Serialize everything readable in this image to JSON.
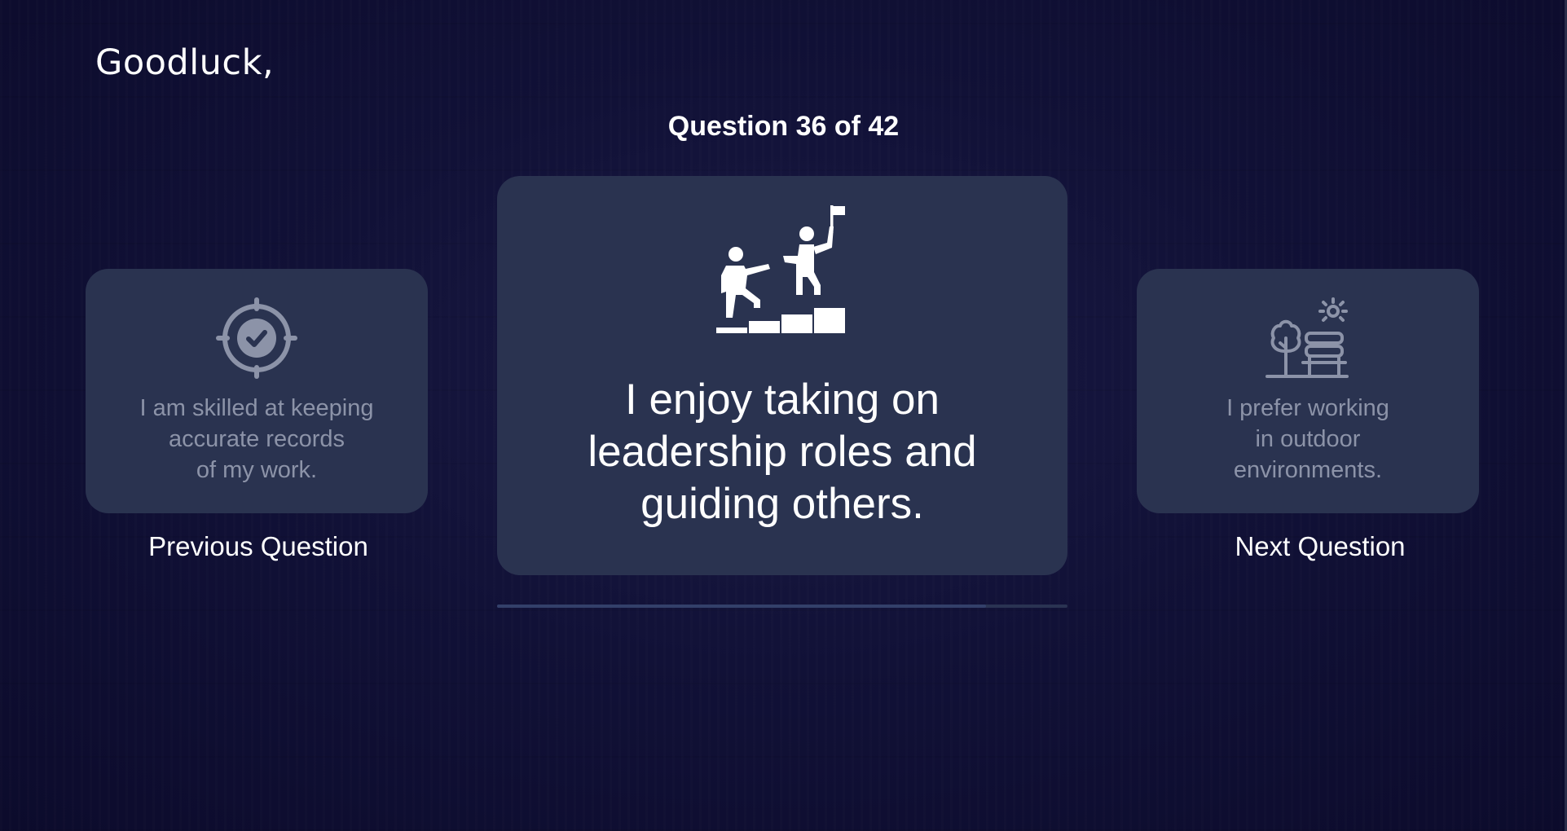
{
  "greeting": "Goodluck,",
  "counter": "Question 36 of 42",
  "progress": {
    "current": 36,
    "total": 42
  },
  "prev_card": {
    "icon": "target-check-icon",
    "text": "I am skilled at keeping\naccurate records\nof my work."
  },
  "current_card": {
    "icon": "leadership-stairs-icon",
    "text": "I enjoy taking on\nleadership roles and\nguiding others."
  },
  "next_card": {
    "icon": "park-bench-tree-sun-icon",
    "text": "I prefer working\nin outdoor\nenvironments."
  },
  "nav": {
    "previous_label": "Previous Question",
    "next_label": "Next Question"
  },
  "colors": {
    "background": "#111137",
    "card": "#2a3350",
    "muted_text": "#8c93a8",
    "text": "#ffffff"
  }
}
